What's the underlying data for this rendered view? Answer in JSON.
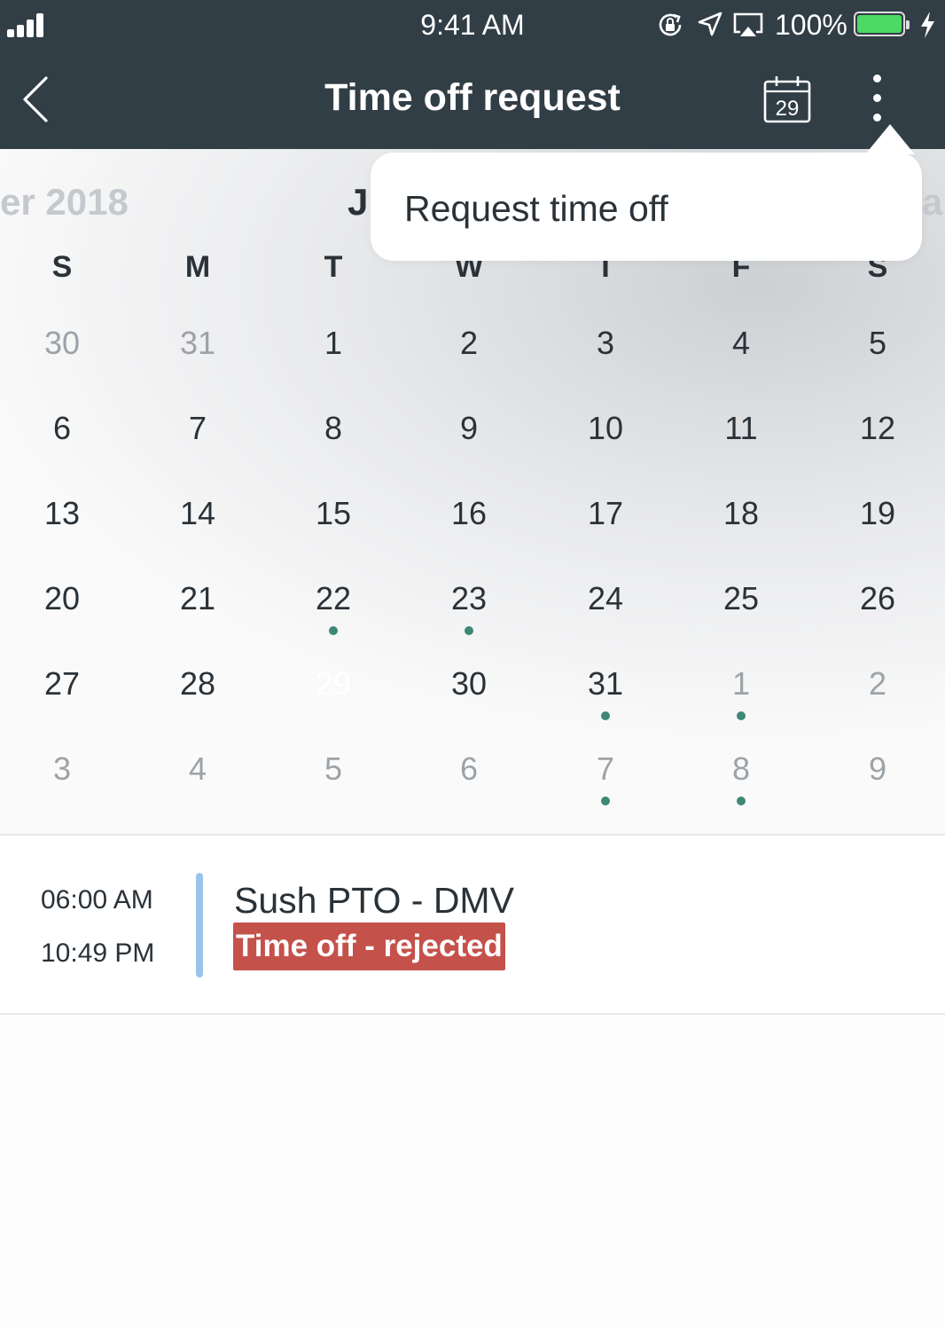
{
  "status_bar": {
    "time": "9:41 AM",
    "battery": "100%"
  },
  "nav": {
    "title": "Time off request",
    "calendar_icon_day": "29"
  },
  "calendar": {
    "prev_month": "er 2018",
    "current_month": "J",
    "next_month": "a",
    "weekdays": [
      "S",
      "M",
      "T",
      "W",
      "T",
      "F",
      "S"
    ],
    "weeks": [
      [
        {
          "d": "30",
          "muted": true
        },
        {
          "d": "31",
          "muted": true
        },
        {
          "d": "1"
        },
        {
          "d": "2"
        },
        {
          "d": "3"
        },
        {
          "d": "4"
        },
        {
          "d": "5"
        }
      ],
      [
        {
          "d": "6"
        },
        {
          "d": "7"
        },
        {
          "d": "8"
        },
        {
          "d": "9"
        },
        {
          "d": "10"
        },
        {
          "d": "11"
        },
        {
          "d": "12"
        }
      ],
      [
        {
          "d": "13"
        },
        {
          "d": "14"
        },
        {
          "d": "15"
        },
        {
          "d": "16"
        },
        {
          "d": "17"
        },
        {
          "d": "18"
        },
        {
          "d": "19"
        }
      ],
      [
        {
          "d": "20"
        },
        {
          "d": "21"
        },
        {
          "d": "22",
          "dot": true
        },
        {
          "d": "23",
          "dot": true
        },
        {
          "d": "24"
        },
        {
          "d": "25"
        },
        {
          "d": "26"
        }
      ],
      [
        {
          "d": "27"
        },
        {
          "d": "28"
        },
        {
          "d": "29",
          "selected": true
        },
        {
          "d": "30"
        },
        {
          "d": "31",
          "dot": true
        },
        {
          "d": "1",
          "muted": true,
          "dot": true
        },
        {
          "d": "2",
          "muted": true
        }
      ],
      [
        {
          "d": "3",
          "muted": true
        },
        {
          "d": "4",
          "muted": true
        },
        {
          "d": "5",
          "muted": true
        },
        {
          "d": "6",
          "muted": true
        },
        {
          "d": "7",
          "muted": true,
          "dot": true
        },
        {
          "d": "8",
          "muted": true,
          "dot": true
        },
        {
          "d": "9",
          "muted": true
        }
      ]
    ]
  },
  "event": {
    "start_time": "06:00 AM",
    "end_time": "10:49 PM",
    "title": "Sush PTO - DMV",
    "status": "Time off - rejected"
  },
  "popover": {
    "item_label": "Request time off"
  },
  "colors": {
    "header": "#323e46",
    "accent": "#3f8776",
    "rejected": "#c5514b",
    "event_bar": "#9bc4ea"
  }
}
